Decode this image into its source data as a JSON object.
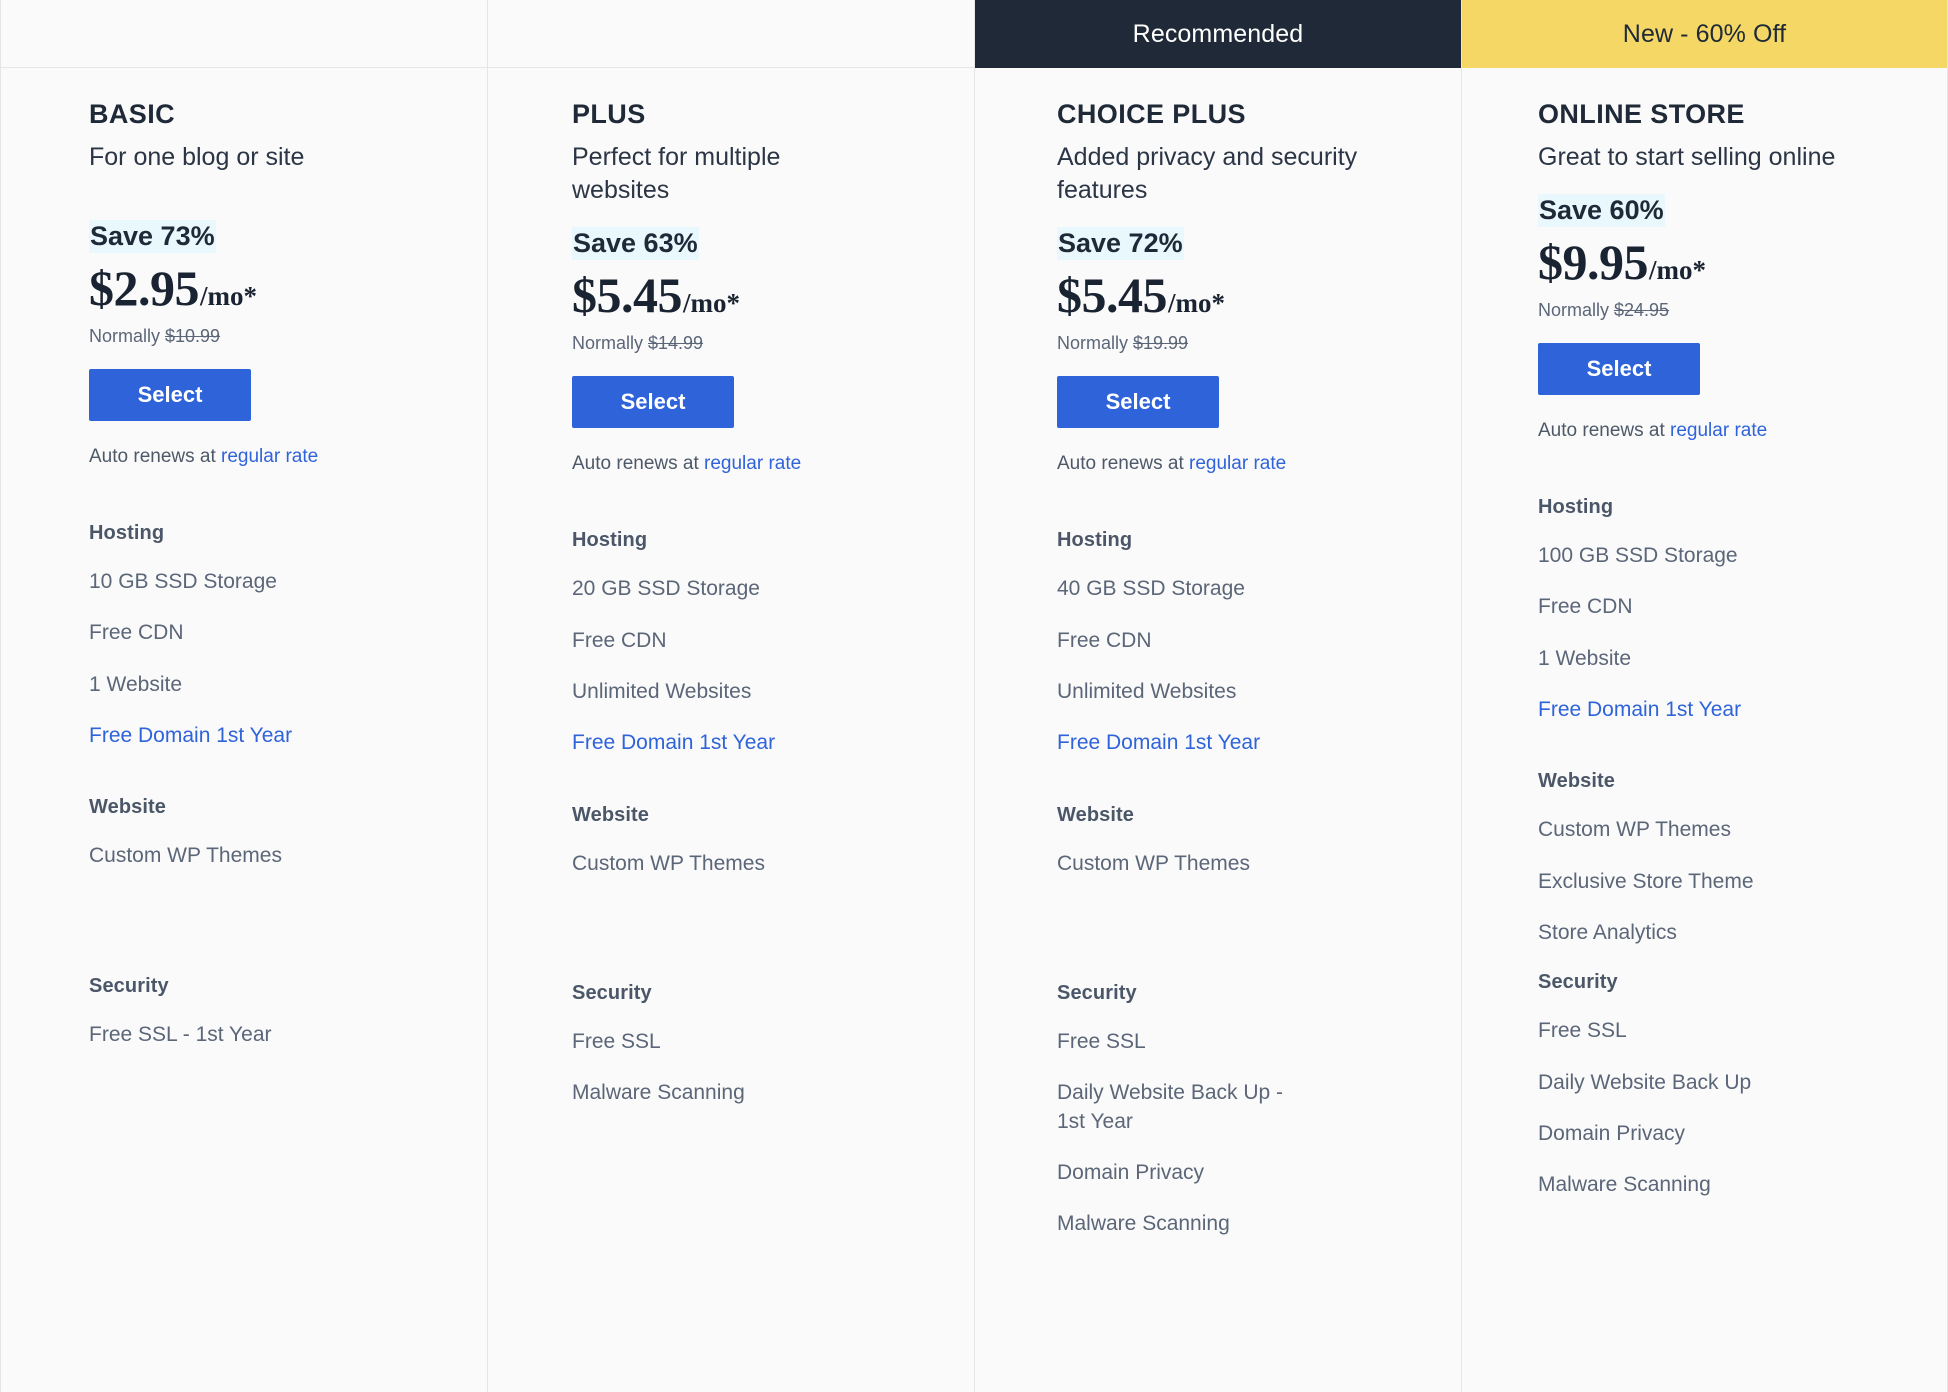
{
  "accent_colors": {
    "primary_blue": "#2f63d9",
    "banner_dark": "#1f2937",
    "banner_yellow": "#f4d765",
    "save_highlight": "#e9f8fd",
    "text_dark": "#1f2937",
    "text_muted": "#5b6678",
    "card_bg": "#fafafa",
    "divider": "#e6e6e8"
  },
  "common": {
    "select_label": "Select",
    "auto_renew_prefix": "Auto renews at ",
    "auto_renew_link": "regular rate",
    "normally_prefix": "Normally ",
    "price_period": "/mo*",
    "group_titles": {
      "hosting": "Hosting",
      "website": "Website",
      "security": "Security"
    }
  },
  "plans": [
    {
      "banner": {
        "label": "",
        "style": "empty"
      },
      "name": "BASIC",
      "tagline": "For one blog or site",
      "save_label": "Save 73%",
      "price": "$2.95",
      "period": "/mo*",
      "normally_price": "$10.99",
      "select_label": "Select",
      "auto_renew_prefix": "Auto renews at ",
      "auto_renew_link": "regular rate",
      "hosting_title": "Hosting",
      "hosting_features": [
        {
          "label": "10 GB SSD Storage",
          "link": false
        },
        {
          "label": "Free CDN",
          "link": false
        },
        {
          "label": "1 Website",
          "link": false
        },
        {
          "label": "Free Domain 1st Year",
          "link": true
        }
      ],
      "website_title": "Website",
      "website_features": [
        {
          "label": "Custom WP Themes",
          "link": false
        }
      ],
      "security_title": "Security",
      "security_features": [
        {
          "label": "Free SSL - 1st Year",
          "link": false
        }
      ]
    },
    {
      "banner": {
        "label": "",
        "style": "empty"
      },
      "name": "PLUS",
      "tagline": "Perfect for multiple websites",
      "save_label": "Save 63%",
      "price": "$5.45",
      "period": "/mo*",
      "normally_price": "$14.99",
      "select_label": "Select",
      "auto_renew_prefix": "Auto renews at ",
      "auto_renew_link": "regular rate",
      "hosting_title": "Hosting",
      "hosting_features": [
        {
          "label": "20 GB SSD Storage",
          "link": false
        },
        {
          "label": "Free CDN",
          "link": false
        },
        {
          "label": "Unlimited Websites",
          "link": false
        },
        {
          "label": "Free Domain 1st Year",
          "link": true
        }
      ],
      "website_title": "Website",
      "website_features": [
        {
          "label": "Custom WP Themes",
          "link": false
        }
      ],
      "security_title": "Security",
      "security_features": [
        {
          "label": "Free SSL",
          "link": false
        },
        {
          "label": "Malware Scanning",
          "link": false
        }
      ]
    },
    {
      "banner": {
        "label": "Recommended",
        "style": "dark"
      },
      "name": "CHOICE PLUS",
      "tagline": "Added privacy and security features",
      "save_label": "Save 72%",
      "price": "$5.45",
      "period": "/mo*",
      "normally_price": "$19.99",
      "select_label": "Select",
      "auto_renew_prefix": "Auto renews at ",
      "auto_renew_link": "regular rate",
      "hosting_title": "Hosting",
      "hosting_features": [
        {
          "label": "40 GB SSD Storage",
          "link": false
        },
        {
          "label": "Free CDN",
          "link": false
        },
        {
          "label": "Unlimited Websites",
          "link": false
        },
        {
          "label": "Free Domain 1st Year",
          "link": true
        }
      ],
      "website_title": "Website",
      "website_features": [
        {
          "label": "Custom WP Themes",
          "link": false
        }
      ],
      "security_title": "Security",
      "security_features": [
        {
          "label": "Free SSL",
          "link": false
        },
        {
          "label": "Daily Website Back Up - 1st Year",
          "link": false
        },
        {
          "label": "Domain Privacy",
          "link": false
        },
        {
          "label": "Malware Scanning",
          "link": false
        }
      ]
    },
    {
      "banner": {
        "label": "New - 60% Off",
        "style": "yellow"
      },
      "name": "ONLINE STORE",
      "tagline": "Great to start selling online",
      "save_label": "Save 60%",
      "price": "$9.95",
      "period": "/mo*",
      "normally_price": "$24.95",
      "select_label": "Select",
      "auto_renew_prefix": "Auto renews at ",
      "auto_renew_link": "regular rate",
      "hosting_title": "Hosting",
      "hosting_features": [
        {
          "label": "100 GB SSD Storage",
          "link": false
        },
        {
          "label": "Free CDN",
          "link": false
        },
        {
          "label": "1 Website",
          "link": false
        },
        {
          "label": "Free Domain 1st Year",
          "link": true
        }
      ],
      "website_title": "Website",
      "website_features": [
        {
          "label": "Custom WP Themes",
          "link": false
        },
        {
          "label": "Exclusive Store Theme",
          "link": false
        },
        {
          "label": "Store Analytics",
          "link": false
        }
      ],
      "security_title": "Security",
      "security_features": [
        {
          "label": "Free SSL",
          "link": false
        },
        {
          "label": "Daily Website Back Up",
          "link": false
        },
        {
          "label": "Domain Privacy",
          "link": false
        },
        {
          "label": "Malware Scanning",
          "link": false
        }
      ]
    }
  ]
}
